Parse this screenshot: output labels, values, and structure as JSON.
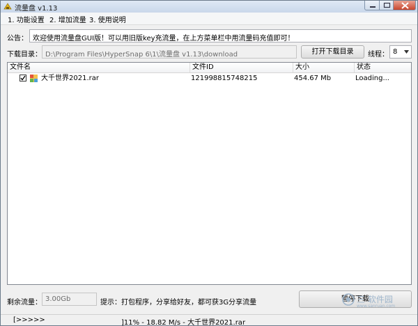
{
  "window": {
    "title": "流量盘 v1.13",
    "minimize_label": "",
    "maximize_label": "",
    "close_label": ""
  },
  "menu": [
    "1. 功能设置",
    "2. 增加流量",
    "3. 使用说明"
  ],
  "notice": {
    "label": "公告：",
    "text": "欢迎使用流量盘GUI版！可以用旧版key充流量，在上方菜单栏中用流量码充值即可！"
  },
  "download": {
    "label": "下载目录：",
    "path": "D:\\Program Files\\HyperSnap 6\\1\\流量盘 v1.13\\download",
    "open_button": "打开下载目录",
    "threads_label": "线程：",
    "threads_value": "8"
  },
  "table": {
    "columns": [
      "文件名",
      "文件ID",
      "大小",
      "状态"
    ],
    "rows": [
      {
        "checked": true,
        "name": "大千世界2021.rar",
        "id": "121998815748215",
        "size": "454.67 Mb",
        "status": "Loading..."
      }
    ]
  },
  "bottom": {
    "remaining_label": "剩余流量：",
    "remaining_value": "3.00Gb",
    "tip": "提示：打包程序，分享给好友，都可获3G分享流量",
    "pause_button": "暂停下载"
  },
  "status": {
    "arrows": "[>>>>>",
    "progress": "]11% -  18.82 M/s - 大千世界2021.rar"
  },
  "watermark": {
    "text": "三 软件园",
    "url": "www.sanruan.com"
  },
  "colors": {
    "accent": "#2f6fb6",
    "close_red": "#c8462e",
    "watermark": "#9fb6cc"
  }
}
